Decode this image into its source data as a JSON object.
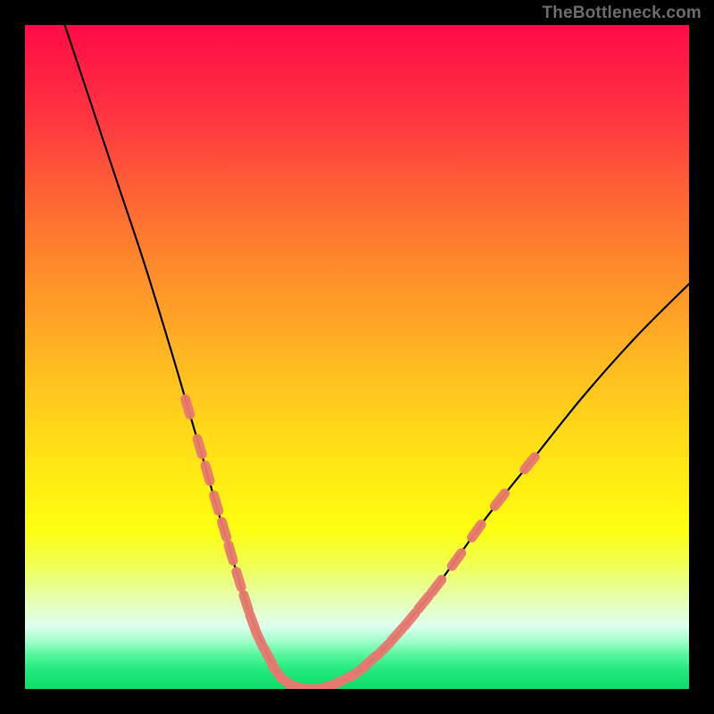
{
  "watermark": "TheBottleneck.com",
  "chart_data": {
    "type": "line",
    "title": "",
    "xlabel": "",
    "ylabel": "",
    "xlim": [
      0,
      100
    ],
    "ylim": [
      0,
      100
    ],
    "legend": null,
    "grid": false,
    "series": [
      {
        "name": "bottleneck-curve",
        "color": "#000000",
        "x": [
          6,
          10,
          14,
          18,
          22,
          24.5,
          27,
          29,
          31,
          32.5,
          34,
          35.5,
          36.6,
          38,
          39.5,
          41,
          43,
          46,
          50,
          54,
          58,
          62,
          66,
          70,
          76,
          84,
          92,
          100
        ],
        "y": [
          100,
          88,
          76,
          64,
          51,
          42.5,
          34,
          27,
          20.5,
          15.5,
          11,
          7.5,
          5,
          2.5,
          1,
          0.3,
          0,
          0.5,
          2.5,
          6,
          10.5,
          15.5,
          21,
          26.5,
          34,
          44,
          53,
          61
        ]
      }
    ],
    "markers": [
      {
        "name": "arm-markers",
        "color": "#E8796F",
        "shape": "pill",
        "points": [
          {
            "x": 24.5,
            "y": 42.5
          },
          {
            "x": 26.3,
            "y": 36.5
          },
          {
            "x": 27.5,
            "y": 32.5
          },
          {
            "x": 28.8,
            "y": 28.0
          },
          {
            "x": 30.0,
            "y": 24.0
          },
          {
            "x": 31.0,
            "y": 20.5
          },
          {
            "x": 32.2,
            "y": 16.5
          },
          {
            "x": 33.3,
            "y": 13.0
          },
          {
            "x": 34.3,
            "y": 10.0
          },
          {
            "x": 35.3,
            "y": 7.5
          },
          {
            "x": 36.6,
            "y": 5.0
          },
          {
            "x": 38.0,
            "y": 2.5
          },
          {
            "x": 39.5,
            "y": 1.0
          },
          {
            "x": 41.0,
            "y": 0.3
          },
          {
            "x": 43.0,
            "y": 0.0
          },
          {
            "x": 44.5,
            "y": 0.1
          },
          {
            "x": 46.0,
            "y": 0.5
          },
          {
            "x": 48.0,
            "y": 1.4
          },
          {
            "x": 50.0,
            "y": 2.5
          },
          {
            "x": 52.0,
            "y": 4.2
          },
          {
            "x": 54.0,
            "y": 6.0
          },
          {
            "x": 56.0,
            "y": 8.2
          },
          {
            "x": 58.0,
            "y": 10.5
          },
          {
            "x": 60.0,
            "y": 13.0
          },
          {
            "x": 62.0,
            "y": 15.5
          },
          {
            "x": 65.0,
            "y": 19.5
          },
          {
            "x": 68.0,
            "y": 23.8
          },
          {
            "x": 71.5,
            "y": 28.5
          },
          {
            "x": 76.0,
            "y": 34.0
          }
        ]
      }
    ]
  }
}
